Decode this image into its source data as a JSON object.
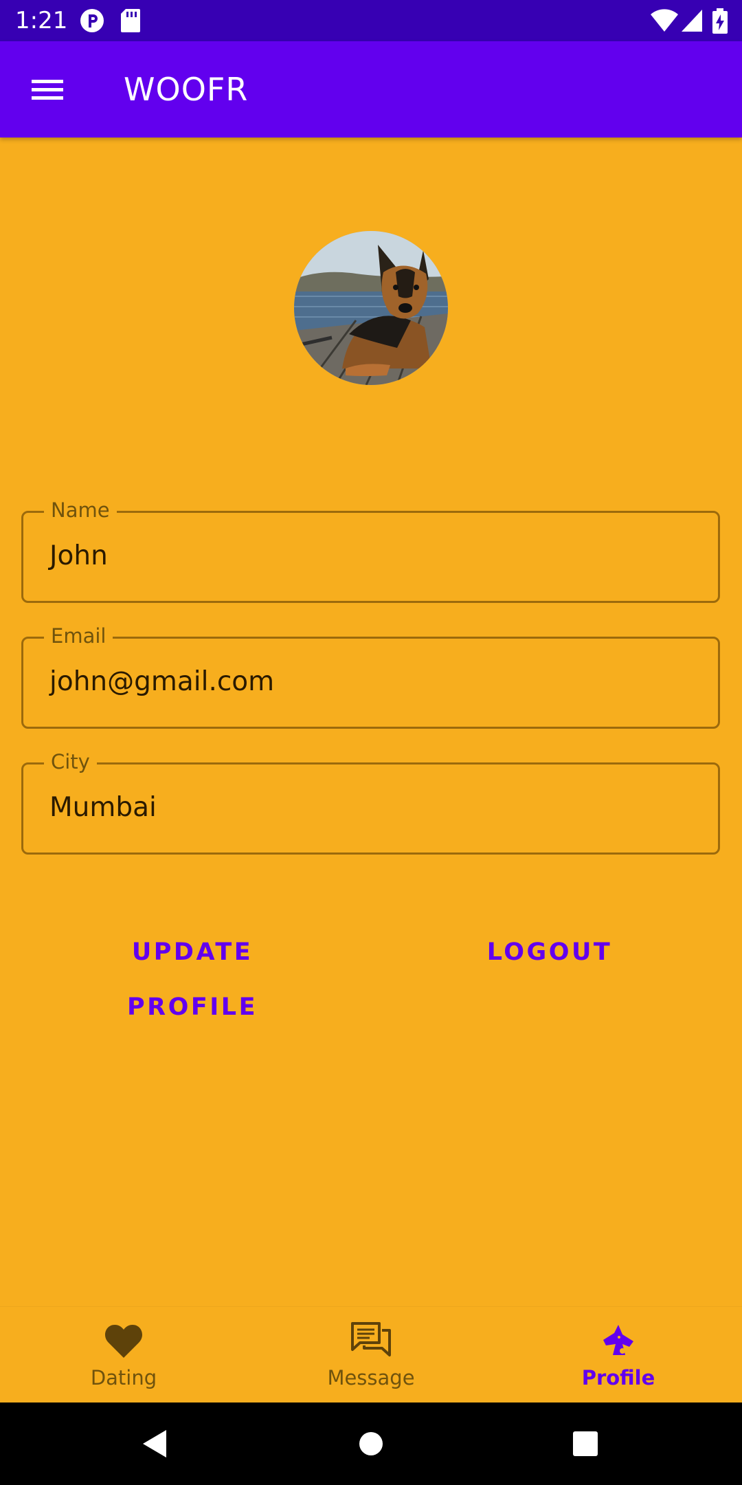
{
  "status_bar": {
    "time": "1:21",
    "icons": [
      "notification-p-icon",
      "sd-card-icon",
      "wifi-icon",
      "signal-icon",
      "battery-charging-icon"
    ]
  },
  "app_bar": {
    "title": "WOOFR",
    "menu_icon": "hamburger-menu-icon",
    "color": "#6200EE"
  },
  "profile": {
    "avatar_subject": "dog-photo"
  },
  "form": {
    "name": {
      "label": "Name",
      "value": "John"
    },
    "email": {
      "label": "Email",
      "value": "john@gmail.com"
    },
    "city": {
      "label": "City",
      "value": "Mumbai"
    }
  },
  "actions": {
    "update_label": "UPDATE PROFILE",
    "logout_label": "LOGOUT"
  },
  "bottom_nav": {
    "items": [
      {
        "label": "Dating",
        "icon": "heart-icon",
        "active": false
      },
      {
        "label": "Message",
        "icon": "chat-bubbles-icon",
        "active": false
      },
      {
        "label": "Profile",
        "icon": "dog-head-icon",
        "active": true
      }
    ]
  },
  "system_nav": {
    "buttons": [
      "back-icon",
      "home-icon",
      "recents-icon"
    ]
  },
  "colors": {
    "background": "#F7AE1E",
    "status_bar": "#3700B3",
    "accent": "#6200EE",
    "field_border": "#9C6A0C"
  }
}
